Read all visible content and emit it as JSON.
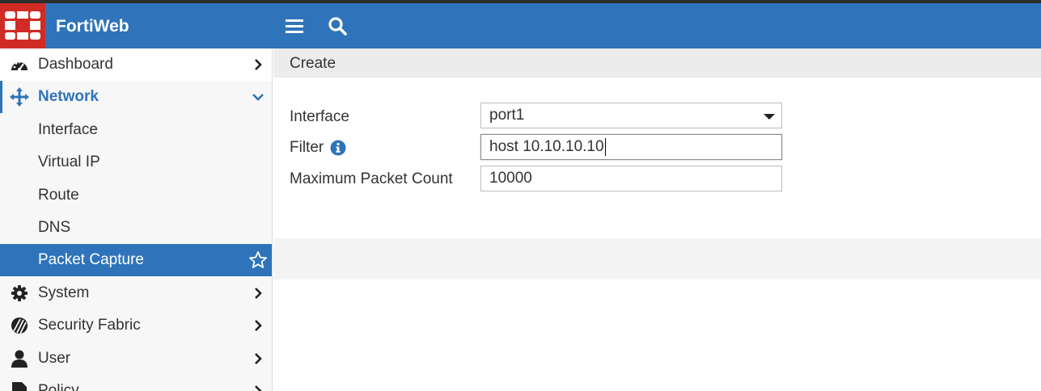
{
  "header": {
    "brand": "FortiWeb",
    "icons": [
      "fortinet-logo-icon",
      "hamburger-menu-icon",
      "search-icon"
    ],
    "accent_color": "#2f74ba",
    "logo_color": "#d02b24"
  },
  "sidebar": {
    "items": [
      {
        "label": "Dashboard",
        "icon": "dashboard-gauge-icon"
      },
      {
        "label": "Network",
        "icon": "arrows-move-icon"
      },
      {
        "label": "Interface"
      },
      {
        "label": "Virtual IP"
      },
      {
        "label": "Route"
      },
      {
        "label": "DNS"
      },
      {
        "label": "Packet Capture",
        "icon": "star-icon"
      },
      {
        "label": "System",
        "icon": "gear-icon"
      },
      {
        "label": "Security Fabric",
        "icon": "security-fabric-icon"
      },
      {
        "label": "User",
        "icon": "user-icon"
      },
      {
        "label": "Policy",
        "icon": "document-icon"
      }
    ]
  },
  "main": {
    "title": "Create",
    "fields": {
      "interface": {
        "label": "Interface",
        "value": "port1"
      },
      "filter": {
        "label": "Filter",
        "value": "host 10.10.10.10",
        "icon": "info-icon"
      },
      "max_packet_count": {
        "label": "Maximum Packet Count",
        "value": "10000"
      }
    }
  }
}
